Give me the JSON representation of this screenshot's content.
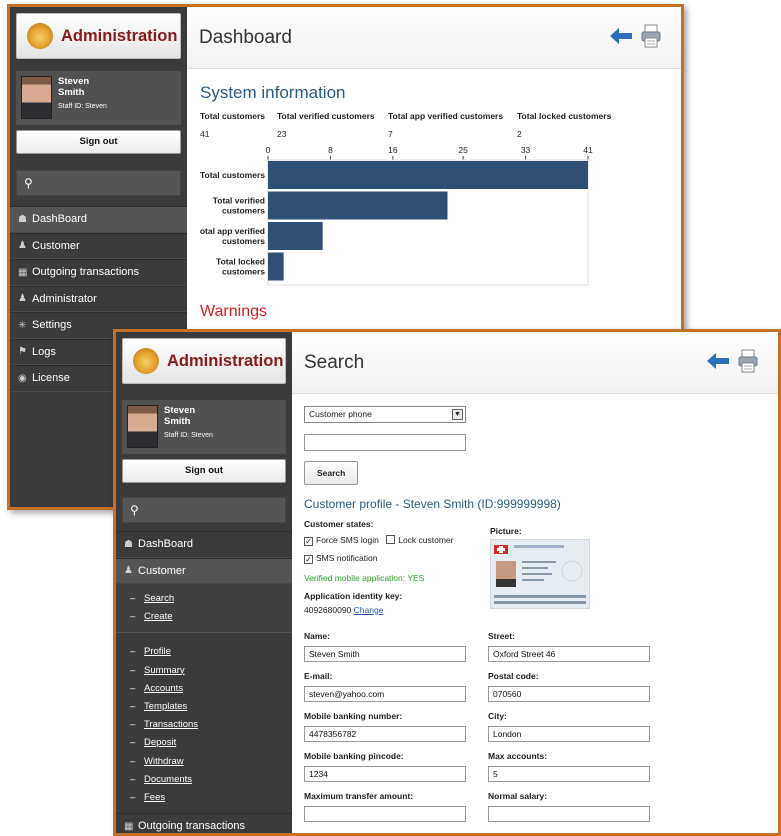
{
  "w1": {
    "app_title": "Administration",
    "user": {
      "first": "Steven",
      "last": "Smith",
      "staff": "Staff ID: Steven"
    },
    "sign_out": "Sign out",
    "menu": [
      "DashBoard",
      "Customer",
      "Outgoing transactions",
      "Administrator",
      "Settings",
      "Logs",
      "License"
    ],
    "page_title": "Dashboard",
    "section_title": "System information",
    "stats": [
      {
        "label": "Total customers",
        "value": "41"
      },
      {
        "label": "Total verified customers",
        "value": "23"
      },
      {
        "label": "Total app verified customers",
        "value": "7"
      },
      {
        "label": "Total locked customers",
        "value": "2"
      }
    ],
    "warnings": "Warnings"
  },
  "chart_data": {
    "type": "bar",
    "orientation": "horizontal",
    "categories": [
      "Total customers",
      "Total verified customers",
      "otal app verified customers",
      "Total locked customers"
    ],
    "values": [
      41,
      23,
      7,
      2
    ],
    "ticks": [
      0,
      8,
      16,
      25,
      33,
      41
    ],
    "xlim": [
      0,
      41
    ],
    "color": "#2f4f75"
  },
  "w2": {
    "app_title": "Administration",
    "user": {
      "first": "Steven",
      "last": "Smith",
      "staff": "Staff ID: Steven"
    },
    "sign_out": "Sign out",
    "menu_top": [
      "DashBoard",
      "Customer"
    ],
    "sub1": [
      "Search",
      "Create"
    ],
    "sub2": [
      "Profile",
      "Summary",
      "Accounts",
      "Templates",
      "Transactions",
      "Deposit",
      "Withdraw",
      "Documents",
      "Fees"
    ],
    "menu_bottom": "Outgoing transactions",
    "page_title": "Search",
    "search_select": "Customer phone",
    "search_button": "Search",
    "profile_title": "Customer profile - Steven Smith (ID:999999998)",
    "states_label": "Customer states:",
    "force_sms": "Force SMS login",
    "lock_customer": "Lock customer",
    "sms_notification": "SMS notification",
    "verified_app": "Verified mobile application: YES",
    "app_key_label": "Application identity key:",
    "app_key_value": "4092680090",
    "change_link": "Change",
    "picture_label": "Picture:",
    "fields_left": [
      {
        "label": "Name:",
        "value": "Steven Smith"
      },
      {
        "label": "E-mail:",
        "value": "steven@yahoo.com"
      },
      {
        "label": "Mobile banking number:",
        "value": "4478356782"
      },
      {
        "label": "Mobile banking pincode:",
        "value": "1234"
      },
      {
        "label": "Maximum transfer amount:",
        "value": ""
      }
    ],
    "fields_right": [
      {
        "label": "Street:",
        "value": "Oxford Street 46"
      },
      {
        "label": "Postal code:",
        "value": "070560"
      },
      {
        "label": "City:",
        "value": "London"
      },
      {
        "label": "Max accounts:",
        "value": "5"
      },
      {
        "label": "Normal salary:",
        "value": ""
      }
    ]
  }
}
